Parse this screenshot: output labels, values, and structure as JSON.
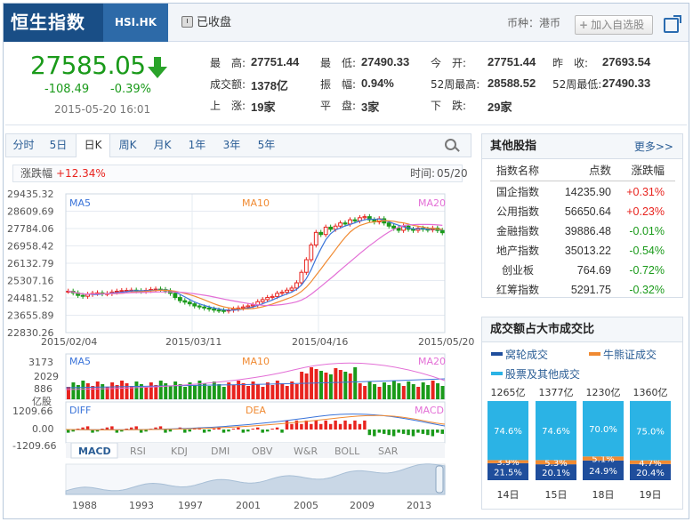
{
  "header": {
    "title": "恒生指数",
    "code": "HSI.HK",
    "status": "已收盘",
    "currency_label": "币种：港币",
    "add_button": "加入自选股"
  },
  "quote": {
    "price": "27585.05",
    "change": "-108.49",
    "change_pct": "-0.39%",
    "time": "2015-05-20 16:01"
  },
  "stats": [
    {
      "label": "最　高:",
      "value": "27751.44",
      "color": "#333"
    },
    {
      "label": "最　低:",
      "value": "27490.33",
      "color": "#333"
    },
    {
      "label": "今　开:",
      "value": "27751.44",
      "color": "#333"
    },
    {
      "label": "昨　收:",
      "value": "27693.54",
      "color": "#333"
    },
    {
      "label": "成交额:",
      "value": "1378亿",
      "color": "#333"
    },
    {
      "label": "振　幅:",
      "value": "0.94%",
      "color": "#333"
    },
    {
      "label": "52周最高:",
      "value": "28588.52",
      "color": "#333"
    },
    {
      "label": "52周最低:",
      "value": "27490.33",
      "color": "#333"
    },
    {
      "label": "上　涨:",
      "value": "19家",
      "color": "#333"
    },
    {
      "label": "平　盘:",
      "value": "3家",
      "color": "#333"
    },
    {
      "label": "下　跌:",
      "value": "29家",
      "color": "#333"
    }
  ],
  "tabs": [
    "分时",
    "5日",
    "日K",
    "周K",
    "月K",
    "1年",
    "3年",
    "5年"
  ],
  "active_tab": "日K",
  "info_bar": {
    "label": "涨跌幅",
    "value": "+12.34%",
    "time_label": "时间:",
    "time_value": "05/20"
  },
  "chart_data": [
    {
      "type": "line",
      "title": "",
      "series_labels": [
        "MA5",
        "MA10",
        "MA20"
      ],
      "y_ticks": [
        "29435.32",
        "28609.69",
        "27784.06",
        "26958.42",
        "26132.79",
        "25307.16",
        "24481.52",
        "23655.89",
        "22830.26"
      ],
      "ylim": [
        22830.26,
        29435.32
      ],
      "x_ticks": [
        "2015/02/04",
        "2015/03/11",
        "2015/04/16",
        "2015/05/20"
      ],
      "close": [
        24800,
        24720,
        24600,
        24560,
        24650,
        24700,
        24720,
        24680,
        24690,
        24760,
        24800,
        24830,
        24840,
        24850,
        24820,
        24800,
        24840,
        24880,
        24900,
        24880,
        24820,
        24700,
        24500,
        24350,
        24280,
        24200,
        24100,
        24050,
        24000,
        23950,
        23900,
        23880,
        23860,
        23900,
        23950,
        24000,
        24050,
        24100,
        24150,
        24300,
        24400,
        24500,
        24550,
        24700,
        24750,
        24850,
        24950,
        25200,
        25700,
        26300,
        27000,
        27600,
        27500,
        27850,
        27750,
        27900,
        28050,
        28000,
        28200,
        28150,
        28300,
        28350,
        28200,
        28100,
        28250,
        28050,
        27900,
        27800,
        27700,
        27900,
        27750,
        27700,
        27800,
        27750,
        27720,
        27800,
        27693,
        27585
      ]
    },
    {
      "type": "bar",
      "title": "",
      "series_labels": [
        "MA5",
        "MA10",
        "MA20"
      ],
      "y_ticks": [
        "3173",
        "2029",
        "886"
      ],
      "unit": "亿股"
    },
    {
      "type": "bar",
      "title": "",
      "series_labels": [
        "DIFF",
        "DEA",
        "MACD"
      ],
      "y_ticks": [
        "1209.66",
        "0.00",
        "-1209.66"
      ]
    }
  ],
  "indicator_tabs": [
    "MACD",
    "RSI",
    "KDJ",
    "DMI",
    "OBV",
    "W&R",
    "BOLL",
    "SAR"
  ],
  "active_indicator": "MACD",
  "year_axis": [
    "1988",
    "1993",
    "1997",
    "2001",
    "2005",
    "2009",
    "2013"
  ],
  "other_indices": {
    "title": "其他股指",
    "more": "更多>>",
    "headers": [
      "指数名称",
      "点数",
      "涨跌幅"
    ],
    "rows": [
      {
        "name": "国企指数",
        "points": "14235.90",
        "change": "+0.31%",
        "color": "#e8231e"
      },
      {
        "name": "公用指数",
        "points": "56650.64",
        "change": "+0.23%",
        "color": "#e8231e"
      },
      {
        "name": "金融指数",
        "points": "39886.48",
        "change": "-0.01%",
        "color": "#1a9a1a"
      },
      {
        "name": "地产指数",
        "points": "35013.22",
        "change": "-0.54%",
        "color": "#1a9a1a"
      },
      {
        "name": "创业板",
        "points": "764.69",
        "change": "-0.72%",
        "color": "#1a9a1a"
      },
      {
        "name": "红筹指数",
        "points": "5291.75",
        "change": "-0.32%",
        "color": "#1a9a1a"
      }
    ]
  },
  "turnover_panel": {
    "title": "成交额占大市成交比",
    "legend": [
      {
        "label": "窝轮成交",
        "color": "#1f4e9c"
      },
      {
        "label": "牛熊证成交",
        "color": "#f08a32"
      },
      {
        "label": "股票及其他成交",
        "color": "#2bb3e5"
      }
    ],
    "chart_data": {
      "type": "bar",
      "stacked": true,
      "categories": [
        "14日",
        "15日",
        "18日",
        "19日"
      ],
      "totals": [
        "1265亿",
        "1377亿",
        "1230亿",
        "1360亿"
      ],
      "series": [
        {
          "name": "窝轮成交",
          "values": [
            21.5,
            20.1,
            24.9,
            20.4
          ],
          "labels": [
            "21.5%",
            "20.1%",
            "24.9%",
            "20.4%"
          ]
        },
        {
          "name": "牛熊证成交",
          "values": [
            3.9,
            5.3,
            5.1,
            4.7
          ],
          "labels": [
            "3.9%",
            "5.3%",
            "5.1%",
            "4.7%"
          ]
        },
        {
          "name": "股票及其他成交",
          "values": [
            74.6,
            74.6,
            70.0,
            75.0
          ],
          "labels": [
            "74.6%",
            "74.6%",
            "70.0%",
            "75.0%"
          ]
        }
      ]
    }
  },
  "colors": {
    "up": "#e8231e",
    "down": "#1a9a1a",
    "accent": "#194e86",
    "ma5": "#3b74d9",
    "ma10": "#f08a32",
    "ma20": "#e36fd6"
  }
}
